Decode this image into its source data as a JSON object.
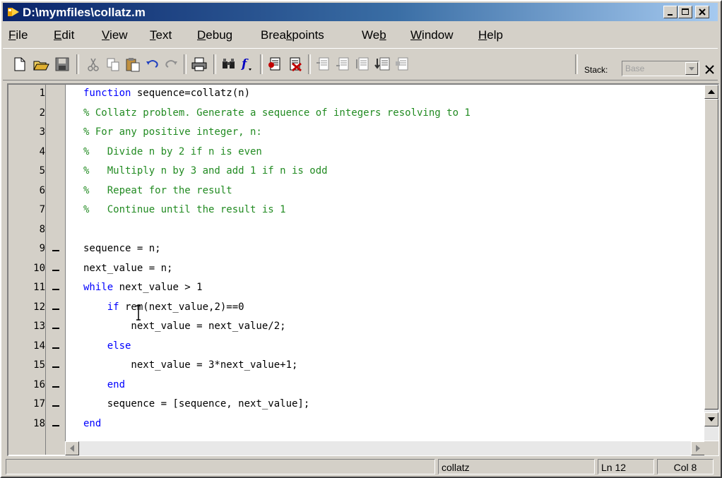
{
  "window": {
    "title": "D:\\mymfiles\\collatz.m"
  },
  "menu": {
    "items": [
      {
        "pre": "",
        "u": "F",
        "post": "ile"
      },
      {
        "pre": "",
        "u": "E",
        "post": "dit"
      },
      {
        "pre": "",
        "u": "V",
        "post": "iew"
      },
      {
        "pre": "",
        "u": "T",
        "post": "ext"
      },
      {
        "pre": "",
        "u": "D",
        "post": "ebug"
      },
      {
        "pre": "Brea",
        "u": "k",
        "post": "points"
      },
      {
        "pre": "We",
        "u": "b",
        "post": ""
      },
      {
        "pre": "",
        "u": "W",
        "post": "indow"
      },
      {
        "pre": "",
        "u": "H",
        "post": "elp"
      }
    ]
  },
  "toolbar": {
    "stack_label": "Stack:",
    "stack_value": "Base"
  },
  "editor": {
    "line_numbers": [
      "1",
      "2",
      "3",
      "4",
      "5",
      "6",
      "7",
      "8",
      "9",
      "10",
      "11",
      "12",
      "13",
      "14",
      "15",
      "16",
      "17",
      "18"
    ],
    "breakpoint_lines": [
      9,
      10,
      11,
      12,
      13,
      14,
      15,
      16,
      17,
      18
    ],
    "lines": [
      [
        {
          "t": "function",
          "c": "kw"
        },
        {
          "t": " sequence=collatz(n)",
          "c": ""
        }
      ],
      [
        {
          "t": "% Collatz problem. Generate a sequence of integers resolving to 1",
          "c": "cm"
        }
      ],
      [
        {
          "t": "% For any positive integer, n:",
          "c": "cm"
        }
      ],
      [
        {
          "t": "%   Divide n by 2 if n is even",
          "c": "cm"
        }
      ],
      [
        {
          "t": "%   Multiply n by 3 and add 1 if n is odd",
          "c": "cm"
        }
      ],
      [
        {
          "t": "%   Repeat for the result",
          "c": "cm"
        }
      ],
      [
        {
          "t": "%   Continue until the result is 1",
          "c": "cm"
        }
      ],
      [],
      [
        {
          "t": "sequence = n;",
          "c": ""
        }
      ],
      [
        {
          "t": "next_value = n;",
          "c": ""
        }
      ],
      [
        {
          "t": "while",
          "c": "kw"
        },
        {
          "t": " next_value > 1",
          "c": ""
        }
      ],
      [
        {
          "t": "    ",
          "c": ""
        },
        {
          "t": "if",
          "c": "kw"
        },
        {
          "t": " rem(next_value,2)==0",
          "c": ""
        }
      ],
      [
        {
          "t": "        next_value = next_value/2;",
          "c": ""
        }
      ],
      [
        {
          "t": "    ",
          "c": ""
        },
        {
          "t": "else",
          "c": "kw"
        }
      ],
      [
        {
          "t": "        next_value = 3*next_value+1;",
          "c": ""
        }
      ],
      [
        {
          "t": "    ",
          "c": ""
        },
        {
          "t": "end",
          "c": "kw"
        }
      ],
      [
        {
          "t": "    sequence = [sequence, next_value];",
          "c": ""
        }
      ],
      [
        {
          "t": "end",
          "c": "kw"
        }
      ]
    ]
  },
  "status": {
    "function_name": "collatz",
    "line": "Ln 12",
    "col": "Col 8"
  }
}
